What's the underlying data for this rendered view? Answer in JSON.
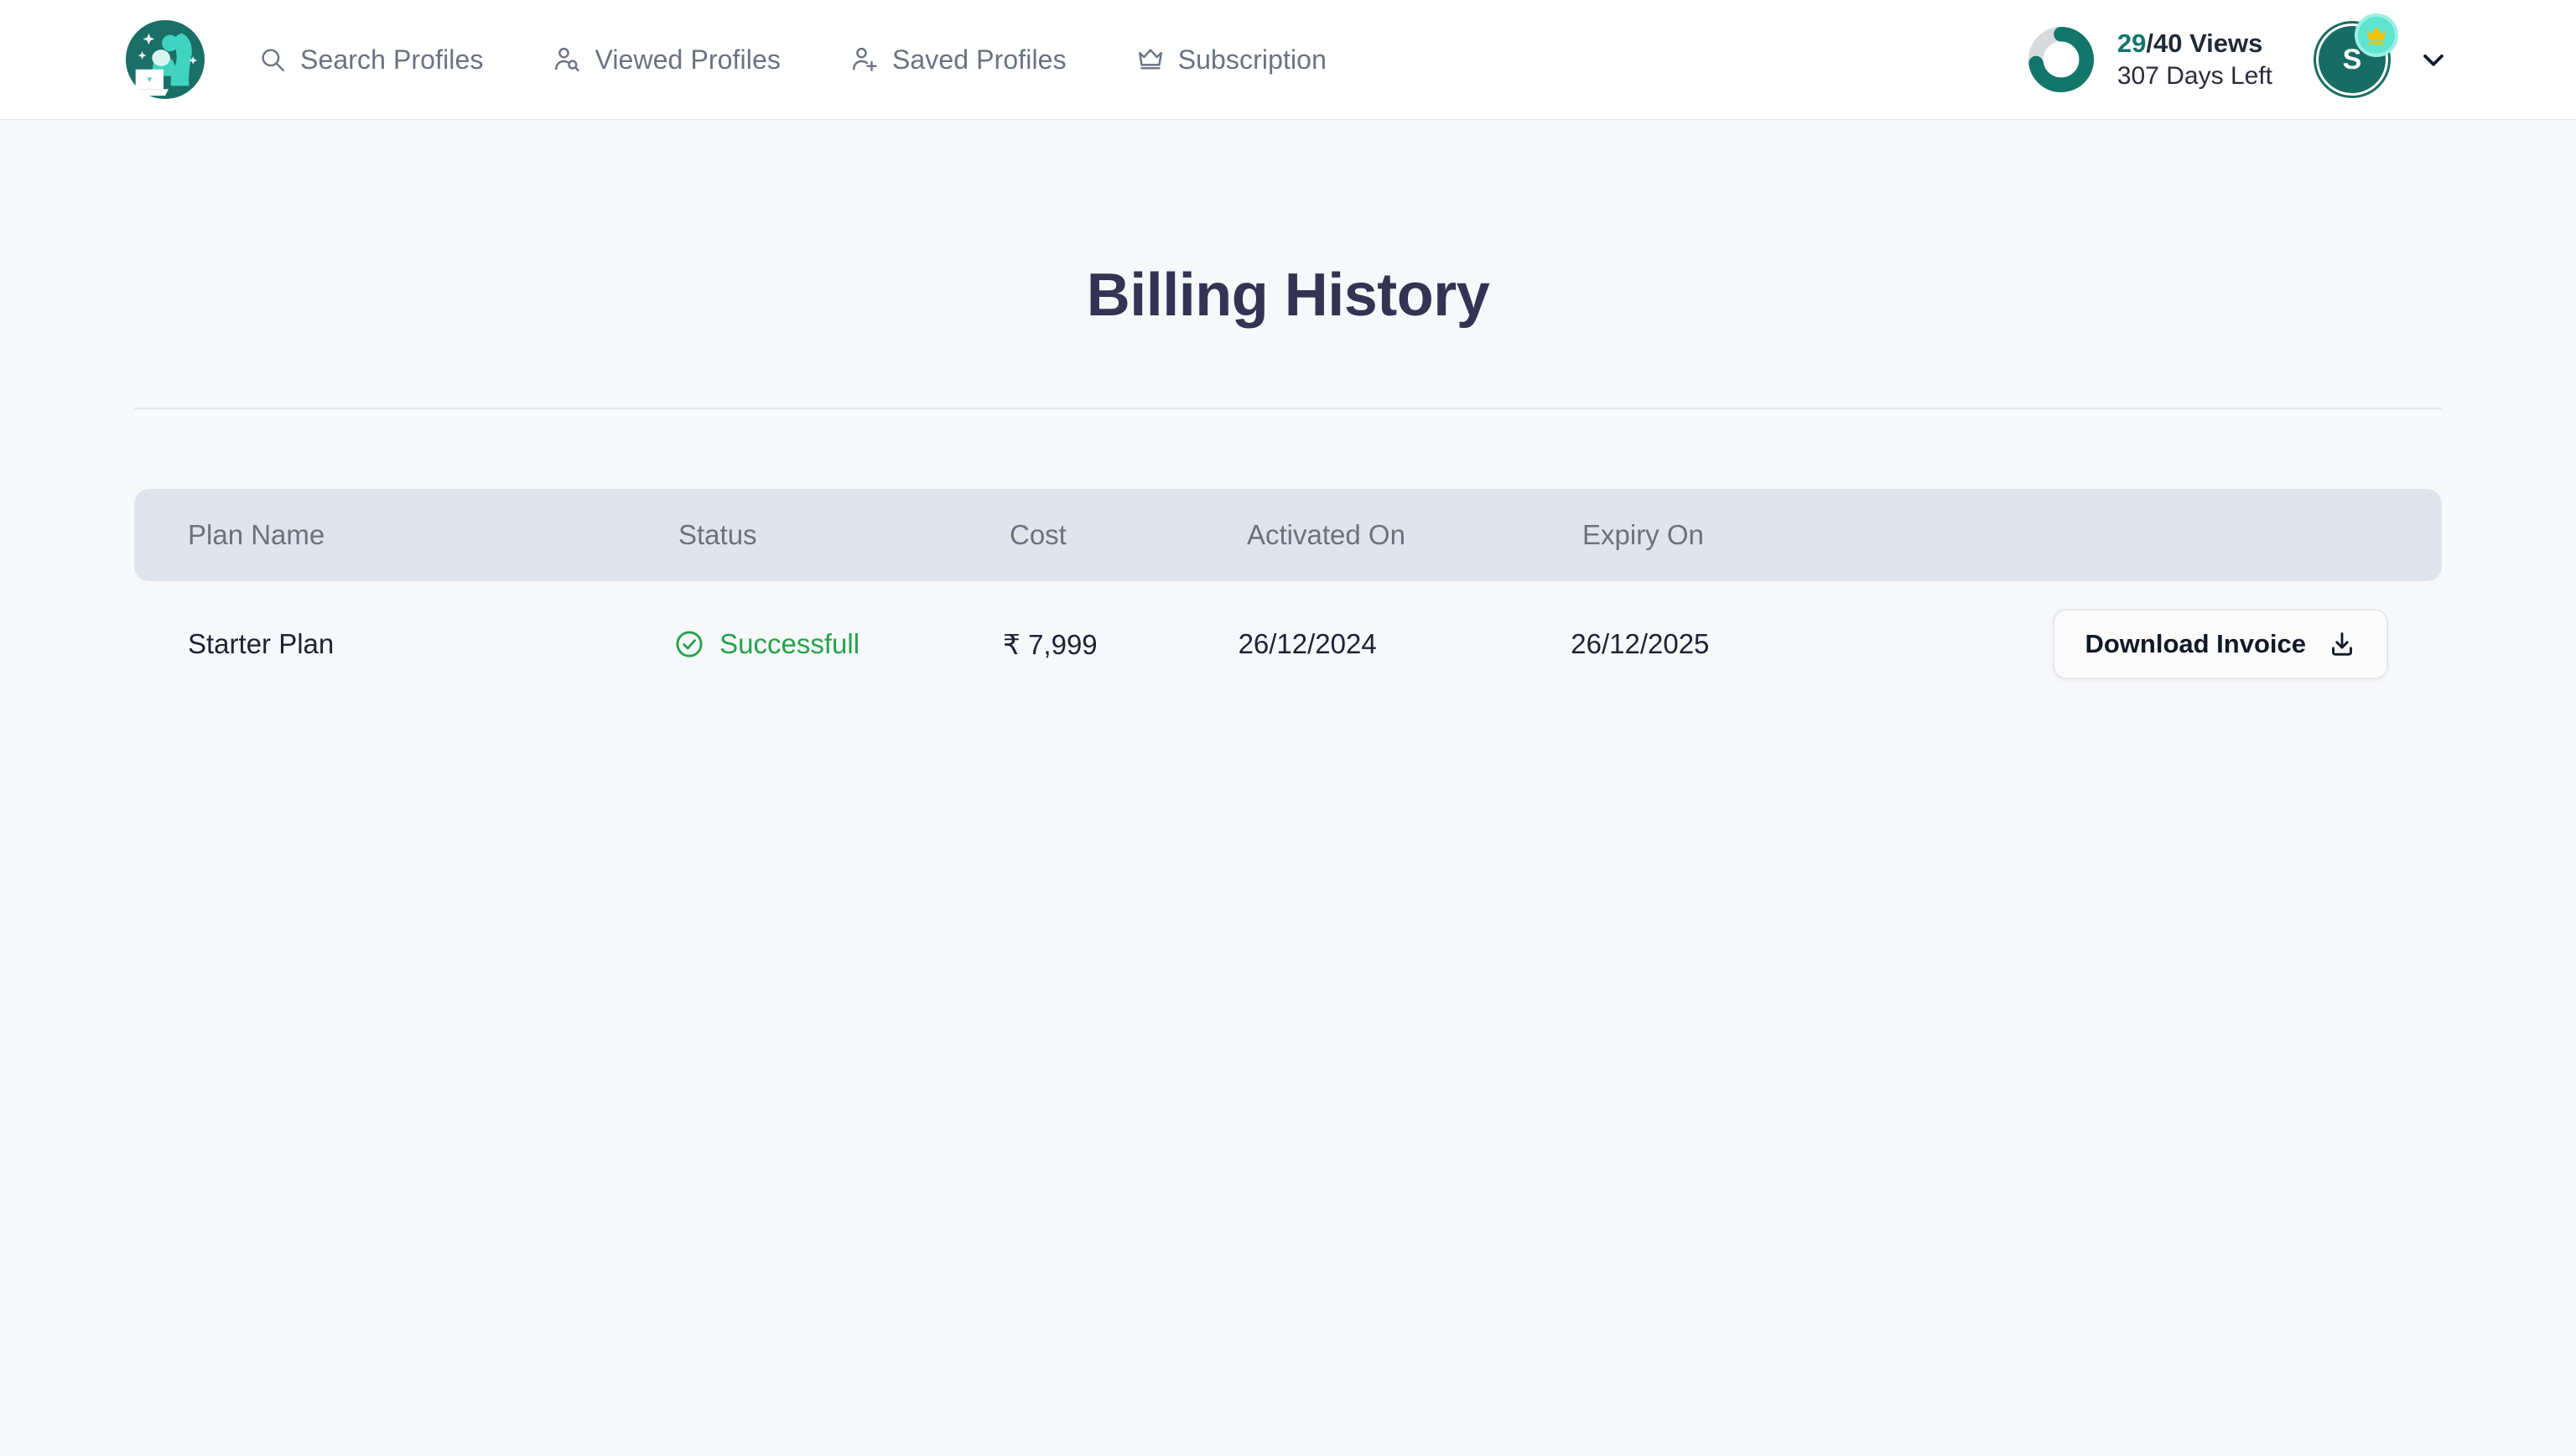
{
  "header": {
    "logo_alt": "woman-with-laptop-logo",
    "nav": [
      {
        "label": "Search Profiles",
        "icon": "search-icon"
      },
      {
        "label": "Viewed Profiles",
        "icon": "person-search-icon"
      },
      {
        "label": "Saved Profiles",
        "icon": "person-add-icon"
      },
      {
        "label": "Subscription",
        "icon": "crown-icon"
      }
    ],
    "usage": {
      "views_used": "29",
      "views_total": "/40 Views",
      "days_left": "307 Days Left",
      "progress_percent": 72.5,
      "ring_color": "#12766b",
      "ring_track_color": "#d9dadc"
    },
    "account": {
      "avatar_initial": "S",
      "avatar_color": "#176d63",
      "badge_icon": "crown-icon",
      "badge_color": "#5fe4cf",
      "caret_icon": "chevron-down-icon"
    }
  },
  "main": {
    "title": "Billing History",
    "table": {
      "columns": [
        "Plan Name",
        "Status",
        "Cost",
        "Activated On",
        "Expiry On"
      ],
      "rows": [
        {
          "plan_name": "Starter Plan",
          "status": "Successfull",
          "status_icon": "check-circle-icon",
          "status_color": "#22a34a",
          "cost": "₹ 7,999",
          "activated_on": "26/12/2024",
          "expiry_on": "26/12/2025",
          "action_label": "Download Invoice",
          "action_icon": "download-icon"
        }
      ]
    }
  }
}
